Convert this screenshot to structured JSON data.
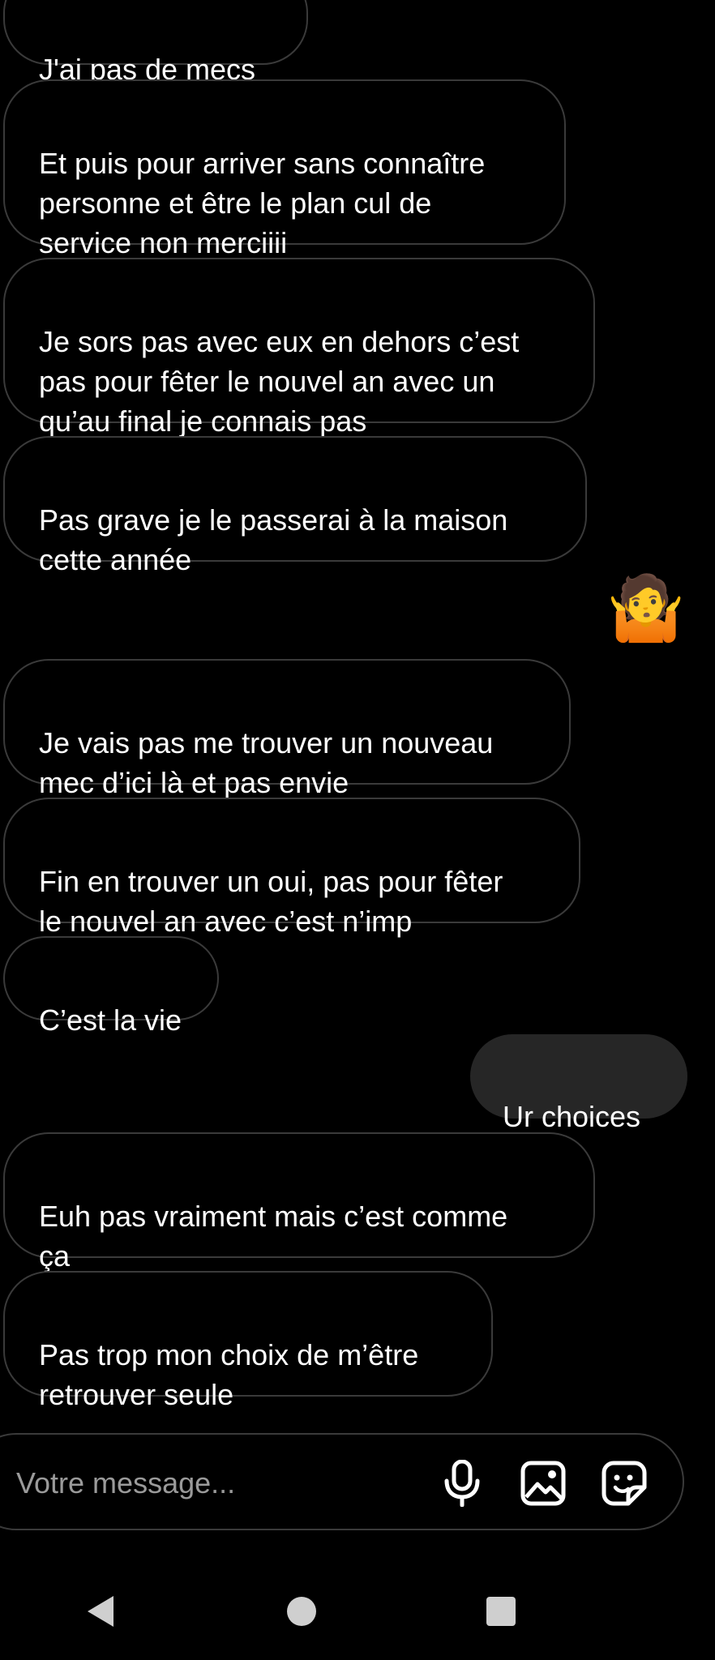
{
  "messages": [
    {
      "text": "J'ai pas de mecs",
      "from": "other"
    },
    {
      "text": "Et puis pour arriver sans connaître\npersonne et être le plan cul de\nservice non merciiii",
      "from": "other"
    },
    {
      "text": "Je sors pas avec eux en dehors c’est\npas pour fêter le nouvel an avec un\nqu’au final je connais pas",
      "from": "other"
    },
    {
      "text": "Pas grave je le passerai à la maison\ncette année",
      "from": "other"
    },
    {
      "text": "🤷",
      "from": "me",
      "type": "emoji",
      "icon": "person-shrugging-emoji"
    },
    {
      "text": "Je vais pas me trouver un nouveau\nmec d’ici là et pas envie",
      "from": "other"
    },
    {
      "text": "Fin en trouver un oui, pas pour fêter\nle nouvel an avec c’est n’imp",
      "from": "other"
    },
    {
      "text": "C’est la vie",
      "from": "other"
    },
    {
      "text": "Ur choices",
      "from": "me"
    },
    {
      "text": "Euh pas vraiment mais c’est comme\nça",
      "from": "other"
    },
    {
      "text": "Pas trop mon choix de m’être\nretrouver seule",
      "from": "other"
    }
  ],
  "composer": {
    "placeholder": "Votre message...",
    "icons": [
      "microphone-icon",
      "image-icon",
      "sticker-icon"
    ]
  },
  "nav": {
    "icons": [
      "back-icon",
      "home-icon",
      "recents-icon"
    ]
  },
  "colors": {
    "background": "#000000",
    "bubble_border": "#3a3a3a",
    "sent_bubble": "#262626",
    "text": "#ffffff",
    "placeholder": "#9a9a9a",
    "nav_icon": "#cfcfcf"
  }
}
